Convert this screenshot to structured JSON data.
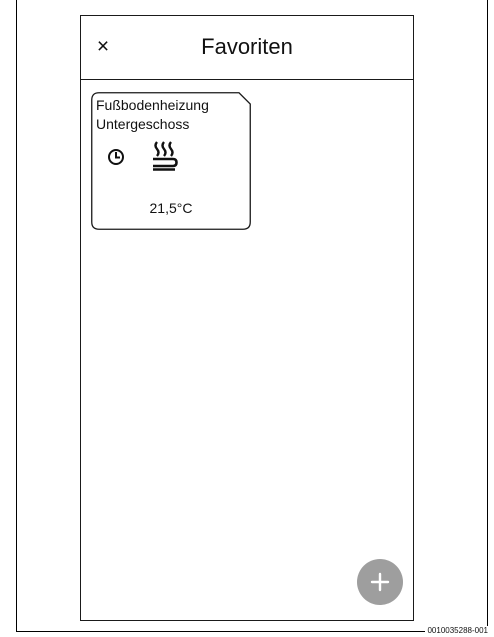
{
  "header": {
    "close_label": "×",
    "title": "Favoriten"
  },
  "favorites": [
    {
      "title_line1": "Fußbodenheizung",
      "title_line2": "Untergeschoss",
      "icons": [
        "timer-icon",
        "floor-heating-icon"
      ],
      "temperature": "21,5°C"
    }
  ],
  "fab": {
    "icon": "plus-icon",
    "color": "#9e9e9e"
  },
  "figure_id": "0010035288-001"
}
